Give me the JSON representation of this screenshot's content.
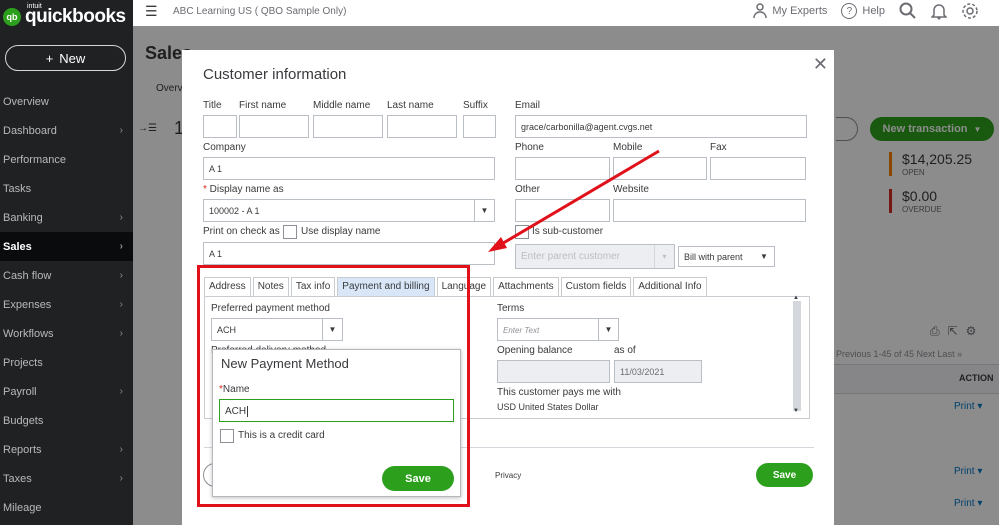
{
  "sidebar": {
    "logo_intuit": "intuit",
    "logo_text": "quickbooks",
    "logo_mark": "qb",
    "new_label": "New",
    "new_plus": "+",
    "items": [
      {
        "label": "Overview",
        "chev": ""
      },
      {
        "label": "Dashboard",
        "chev": "›"
      },
      {
        "label": "Performance",
        "chev": ""
      },
      {
        "label": "Tasks",
        "chev": ""
      },
      {
        "label": "Banking",
        "chev": "›"
      },
      {
        "label": "Sales",
        "chev": "›"
      },
      {
        "label": "Cash flow",
        "chev": "›"
      },
      {
        "label": "Expenses",
        "chev": "›"
      },
      {
        "label": "Workflows",
        "chev": "›"
      },
      {
        "label": "Projects",
        "chev": ""
      },
      {
        "label": "Payroll",
        "chev": "›"
      },
      {
        "label": "Budgets",
        "chev": ""
      },
      {
        "label": "Reports",
        "chev": "›"
      },
      {
        "label": "Taxes",
        "chev": "›"
      },
      {
        "label": "Mileage",
        "chev": ""
      }
    ]
  },
  "topbar": {
    "company": "ABC Learning US ( QBO Sample Only)",
    "my_experts": "My Experts",
    "help": "Help"
  },
  "background": {
    "page_title": "Sales",
    "tab_partial": "Overv",
    "customer_num": "1",
    "new_transaction": "New transaction",
    "open_amount": "$14,205.25",
    "open_label": "OPEN",
    "overdue_amount": "$0.00",
    "overdue_label": "OVERDUE",
    "pagination": "Previous   1-45 of 45   Next   Last »",
    "action_header": "ACTION",
    "print_label": "Print"
  },
  "modal": {
    "title": "Customer information",
    "labels": {
      "title": "Title",
      "first_name": "First name",
      "middle_name": "Middle name",
      "last_name": "Last name",
      "suffix": "Suffix",
      "email": "Email",
      "company": "Company",
      "phone": "Phone",
      "mobile": "Mobile",
      "fax": "Fax",
      "display_name": "Display name as",
      "other": "Other",
      "website": "Website",
      "print_on_check": "Print on check as",
      "use_display_name": "Use display name",
      "is_sub_customer": "Is sub-customer"
    },
    "values": {
      "email": "grace/carbonilla@agent.cvgs.net",
      "company": "A 1",
      "display_name": "100002 - A 1",
      "print_on_check": "A 1",
      "parent_customer_placeholder": "Enter parent customer",
      "bill_with_parent": "Bill with parent"
    },
    "tabs": [
      "Address",
      "Notes",
      "Tax info",
      "Payment and billing",
      "Language",
      "Attachments",
      "Custom fields",
      "Additional Info"
    ],
    "payment": {
      "preferred_payment_method_label": "Preferred payment method",
      "preferred_payment_method_value": "ACH",
      "preferred_delivery_label": "Preferred delivery method",
      "terms_label": "Terms",
      "terms_placeholder": "Enter Text",
      "opening_balance_label": "Opening balance",
      "as_of_label": "as of",
      "as_of_value": "11/03/2021",
      "pays_me_with_label": "This customer pays me with",
      "currency_value": "USD United States Dollar"
    },
    "privacy": "Privacy",
    "save": "Save"
  },
  "popup": {
    "title": "New Payment Method",
    "name_label": "Name",
    "name_value": "ACH",
    "credit_card_label": "This is a credit card",
    "save": "Save"
  },
  "colors": {
    "brand_green": "#2ca01c",
    "sidebar_bg": "#1f2123",
    "annotation_red": "#e0111b"
  }
}
